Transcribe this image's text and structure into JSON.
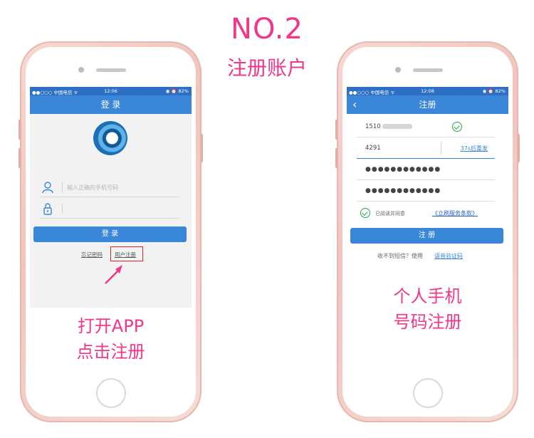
{
  "header": {
    "title": "NO.2",
    "subtitle": "注册账户"
  },
  "left_phone": {
    "status": {
      "carrier": "●●○○○ 中国电信 ᯤ",
      "time": "12:06",
      "right": "◉ ⏰ 82%"
    },
    "nav_title": "登 录",
    "phone_placeholder": "输入正确的手机号码",
    "login_button": "登 录",
    "forgot_link": "忘记密码",
    "register_link": "用户注册",
    "caption_line1": "打开APP",
    "caption_line2": "点击注册"
  },
  "right_phone": {
    "status": {
      "carrier": "●●○○○ 中国电信 ᯤ",
      "time": "12:08",
      "right": "◉ ⏰ 82%"
    },
    "nav_title": "注册",
    "back_glyph": "‹",
    "phone_value": "1510",
    "code_value": "4291",
    "resend_label": "37s后重发",
    "password_dots": "●●●●●●●●●●●●",
    "confirm_dots": "●●●●●●●●●●●●",
    "agree_text": "已阅读并同意",
    "terms_link": "《立刷服务条款》",
    "register_button": "注 册",
    "no_sms_text": "收不到短信？使用",
    "voice_link": "语音验证码",
    "caption_line1": "个人手机",
    "caption_line2": "号码注册"
  },
  "colors": {
    "accent": "#3a86d8",
    "pink": "#f0378a",
    "green": "#27a844",
    "red": "#e0232a"
  }
}
